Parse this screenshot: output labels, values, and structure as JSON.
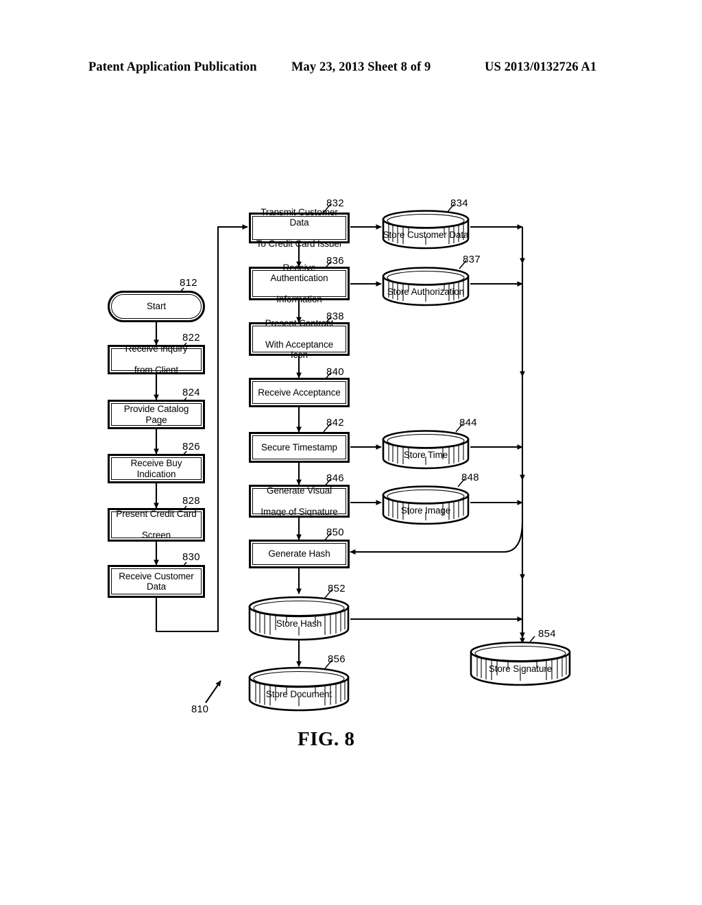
{
  "header": {
    "publication": "Patent Application Publication",
    "date_sheet": "May 23, 2013  Sheet 8 of 9",
    "patent_number": "US 2013/0132726 A1"
  },
  "figure": {
    "caption": "FIG. 8",
    "diagram_ref": "810",
    "type": "flowchart"
  },
  "nodes": {
    "start": {
      "ref": "812",
      "label": "Start"
    },
    "inquiry": {
      "ref": "822",
      "label": "Receive inquiry\nfrom Client",
      "line1": "Receive inquiry",
      "line2": "from Client"
    },
    "catalog": {
      "ref": "824",
      "label": "Provide Catalog Page"
    },
    "buy": {
      "ref": "826",
      "label": "Receive Buy Indication"
    },
    "ccscreen": {
      "ref": "828",
      "line1": "Present Credit Card",
      "line2": "Screen"
    },
    "custdata": {
      "ref": "830",
      "label": "Receive Customer Data"
    },
    "transmit": {
      "ref": "832",
      "line1": "Transmit Customer Data",
      "line2": "To Credit Card Issuer"
    },
    "storecust": {
      "ref": "834",
      "label": "Store Customer Data"
    },
    "auth": {
      "ref": "836",
      "line1": "Receive Authentication",
      "line2": "Information"
    },
    "storeauth": {
      "ref": "837",
      "label": "Store Authorization"
    },
    "contract": {
      "ref": "838",
      "line1": "Present Contract",
      "line2": "With Acceptance Icon"
    },
    "acceptance": {
      "ref": "840",
      "label": "Receive Acceptance"
    },
    "timestamp": {
      "ref": "842",
      "label": "Secure Timestamp"
    },
    "storetime": {
      "ref": "844",
      "label": "Store Time"
    },
    "visualimage": {
      "ref": "846",
      "line1": "Generate Visual",
      "line2": "Image of Signature"
    },
    "storeimage": {
      "ref": "848",
      "label": "Store Image"
    },
    "hash": {
      "ref": "850",
      "label": "Generate Hash"
    },
    "storehash": {
      "ref": "852",
      "label": "Store Hash"
    },
    "storesig": {
      "ref": "854",
      "label": "Store Signature"
    },
    "storedoc": {
      "ref": "856",
      "label": "Store Document"
    }
  },
  "colors": {
    "ink": "#000000",
    "paper": "#ffffff"
  }
}
